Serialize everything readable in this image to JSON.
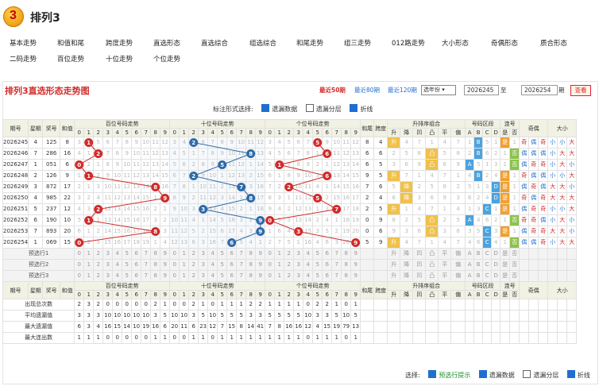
{
  "app": {
    "title": "排列3",
    "logo_text": "3"
  },
  "nav": [
    "基本走势",
    "和值和尾",
    "跨度走势",
    "直选形态",
    "直选综合",
    "组选综合",
    "和尾走势",
    "组三走势",
    "012路走势",
    "大小形态",
    "奇偶形态",
    "质合形态",
    "二码走势",
    "百位走势",
    "十位走势",
    "个位走势"
  ],
  "panel": {
    "title": "排列3直选形态走势图",
    "recent": [
      "最近50期",
      "最近80期",
      "最近120期"
    ],
    "select_label": "选年份",
    "from": "2026245",
    "to_label": "至",
    "to": "2026254",
    "period_label": "期",
    "query": "查看"
  },
  "options": {
    "label": "标注形式选择:",
    "items": [
      {
        "label": "遗漏数据",
        "checked": true
      },
      {
        "label": "遗漏分层",
        "checked": false
      },
      {
        "label": "折线",
        "checked": true
      }
    ]
  },
  "headers": {
    "issue": "期号",
    "week": "星期",
    "prize": "奖号",
    "sum": "和值",
    "bai": "百位号码走势",
    "shi": "十位号码走势",
    "ge": "个位号码走势",
    "hewei": "和尾",
    "kuadu": "跨度",
    "pailie": "升排序组合",
    "pailie_items": [
      "升",
      "降",
      "凹",
      "凸",
      "平",
      "偏"
    ],
    "qujian": "号码区段",
    "qujian_items": [
      "A",
      "B",
      "C",
      "D"
    ],
    "lianhao": "连号",
    "lianhao_items": [
      "是",
      "否"
    ],
    "jiou": "奇偶",
    "daxiao": "大小",
    "digits": [
      "0",
      "1",
      "2",
      "3",
      "4",
      "5",
      "6",
      "7",
      "8",
      "9"
    ]
  },
  "rows": [
    {
      "issue": "2026245",
      "week": "4",
      "prize": "125",
      "sum": "8",
      "b": 1,
      "s": 2,
      "g": 5,
      "hewei": "8",
      "kuadu": "4",
      "pl": "升",
      "qj": "B",
      "lh": "是",
      "jo": [
        "奇",
        "偶",
        "奇"
      ],
      "dx": [
        "小",
        "小",
        "大"
      ]
    },
    {
      "issue": "2026246",
      "week": "7",
      "prize": "286",
      "sum": "16",
      "b": 2,
      "s": 8,
      "g": 6,
      "hewei": "6",
      "kuadu": "6",
      "pl": "凸",
      "qj": "B",
      "lh": "否",
      "jo": [
        "偶",
        "偶",
        "偶"
      ],
      "dx": [
        "小",
        "大",
        "大"
      ]
    },
    {
      "issue": "2026247",
      "week": "1",
      "prize": "051",
      "sum": "6",
      "b": 0,
      "s": 5,
      "g": 1,
      "hewei": "6",
      "kuadu": "5",
      "pl": "凸",
      "qj": "A",
      "lh": "否",
      "jo": [
        "偶",
        "奇",
        "奇"
      ],
      "dx": [
        "小",
        "大",
        "小"
      ]
    },
    {
      "issue": "2026248",
      "week": "2",
      "prize": "126",
      "sum": "9",
      "b": 1,
      "s": 2,
      "g": 6,
      "hewei": "9",
      "kuadu": "5",
      "pl": "升",
      "qj": "B",
      "lh": "是",
      "jo": [
        "奇",
        "偶",
        "偶"
      ],
      "dx": [
        "小",
        "小",
        "大"
      ]
    },
    {
      "issue": "2026249",
      "week": "3",
      "prize": "872",
      "sum": "17",
      "b": 8,
      "s": 7,
      "g": 2,
      "hewei": "7",
      "kuadu": "6",
      "pl": "降",
      "qj": "D",
      "lh": "是",
      "jo": [
        "偶",
        "奇",
        "偶"
      ],
      "dx": [
        "大",
        "大",
        "小"
      ]
    },
    {
      "issue": "2026250",
      "week": "4",
      "prize": "985",
      "sum": "22",
      "b": 9,
      "s": 8,
      "g": 5,
      "hewei": "2",
      "kuadu": "4",
      "pl": "降",
      "qj": "D",
      "lh": "是",
      "jo": [
        "奇",
        "偶",
        "奇"
      ],
      "dx": [
        "大",
        "大",
        "大"
      ]
    },
    {
      "issue": "2026251",
      "week": "5",
      "prize": "237",
      "sum": "12",
      "b": 2,
      "s": 3,
      "g": 7,
      "hewei": "2",
      "kuadu": "5",
      "pl": "升",
      "qj": "C",
      "lh": "是",
      "jo": [
        "偶",
        "奇",
        "奇"
      ],
      "dx": [
        "小",
        "小",
        "大"
      ]
    },
    {
      "issue": "2026252",
      "week": "6",
      "prize": "190",
      "sum": "10",
      "b": 1,
      "s": 9,
      "g": 0,
      "hewei": "0",
      "kuadu": "9",
      "pl": "凸",
      "qj": "A",
      "lh": "否",
      "jo": [
        "奇",
        "奇",
        "偶"
      ],
      "dx": [
        "小",
        "大",
        "小"
      ]
    },
    {
      "issue": "2026253",
      "week": "7",
      "prize": "893",
      "sum": "20",
      "b": 8,
      "s": 9,
      "g": 3,
      "hewei": "0",
      "kuadu": "6",
      "pl": "凸",
      "qj": "C",
      "lh": "是",
      "jo": [
        "偶",
        "奇",
        "奇"
      ],
      "dx": [
        "大",
        "大",
        "小"
      ]
    },
    {
      "issue": "2026254",
      "week": "1",
      "prize": "069",
      "sum": "15",
      "b": 0,
      "s": 6,
      "g": 9,
      "hewei": "5",
      "kuadu": "9",
      "pl": "升",
      "qj": "C",
      "lh": "否",
      "jo": [
        "偶",
        "偶",
        "奇"
      ],
      "dx": [
        "小",
        "大",
        "大"
      ]
    }
  ],
  "preselect": [
    "预选行1",
    "预选行2",
    "预选行3"
  ],
  "stats": [
    {
      "label": "出现总次数",
      "b": [
        "2",
        "3",
        "2",
        "0",
        "0",
        "0",
        "0",
        "0",
        "2",
        "1"
      ],
      "s": [
        "0",
        "0",
        "2",
        "1",
        "0",
        "1",
        "1",
        "1",
        "2",
        "2"
      ],
      "g": [
        "1",
        "1",
        "1",
        "1",
        "0",
        "2",
        "2",
        "1",
        "0",
        "1"
      ]
    },
    {
      "label": "平均遗漏值",
      "b": [
        "3",
        "3",
        "3",
        "10",
        "10",
        "10",
        "10",
        "10",
        "3",
        "5"
      ],
      "s": [
        "10",
        "10",
        "3",
        "5",
        "10",
        "5",
        "5",
        "5",
        "3",
        "3"
      ],
      "g": [
        "5",
        "5",
        "5",
        "5",
        "10",
        "3",
        "3",
        "5",
        "10",
        "5"
      ]
    },
    {
      "label": "最大遗漏值",
      "b": [
        "6",
        "3",
        "4",
        "16",
        "15",
        "14",
        "10",
        "19",
        "16",
        "6"
      ],
      "s": [
        "20",
        "11",
        "6",
        "23",
        "12",
        "7",
        "15",
        "8",
        "14",
        "41"
      ],
      "g": [
        "7",
        "8",
        "16",
        "16",
        "12",
        "4",
        "15",
        "19",
        "79",
        "13"
      ]
    },
    {
      "label": "最大连出数",
      "b": [
        "1",
        "1",
        "1",
        "0",
        "0",
        "0",
        "0",
        "0",
        "1",
        "1"
      ],
      "s": [
        "0",
        "0",
        "1",
        "1",
        "0",
        "1",
        "1",
        "1",
        "1",
        "1"
      ],
      "g": [
        "1",
        "1",
        "1",
        "1",
        "0",
        "1",
        "1",
        "1",
        "0",
        "1"
      ]
    }
  ],
  "bottom": {
    "label": "选择:",
    "items": [
      {
        "label": "预选行提示",
        "checked": true
      },
      {
        "label": "遗漏数据",
        "checked": true
      },
      {
        "label": "遗漏分层",
        "checked": false
      },
      {
        "label": "折线",
        "checked": true
      }
    ]
  },
  "colors": {
    "red": "#d12b2b",
    "blue": "#2e6aa8",
    "header": "#f1f1e4"
  }
}
